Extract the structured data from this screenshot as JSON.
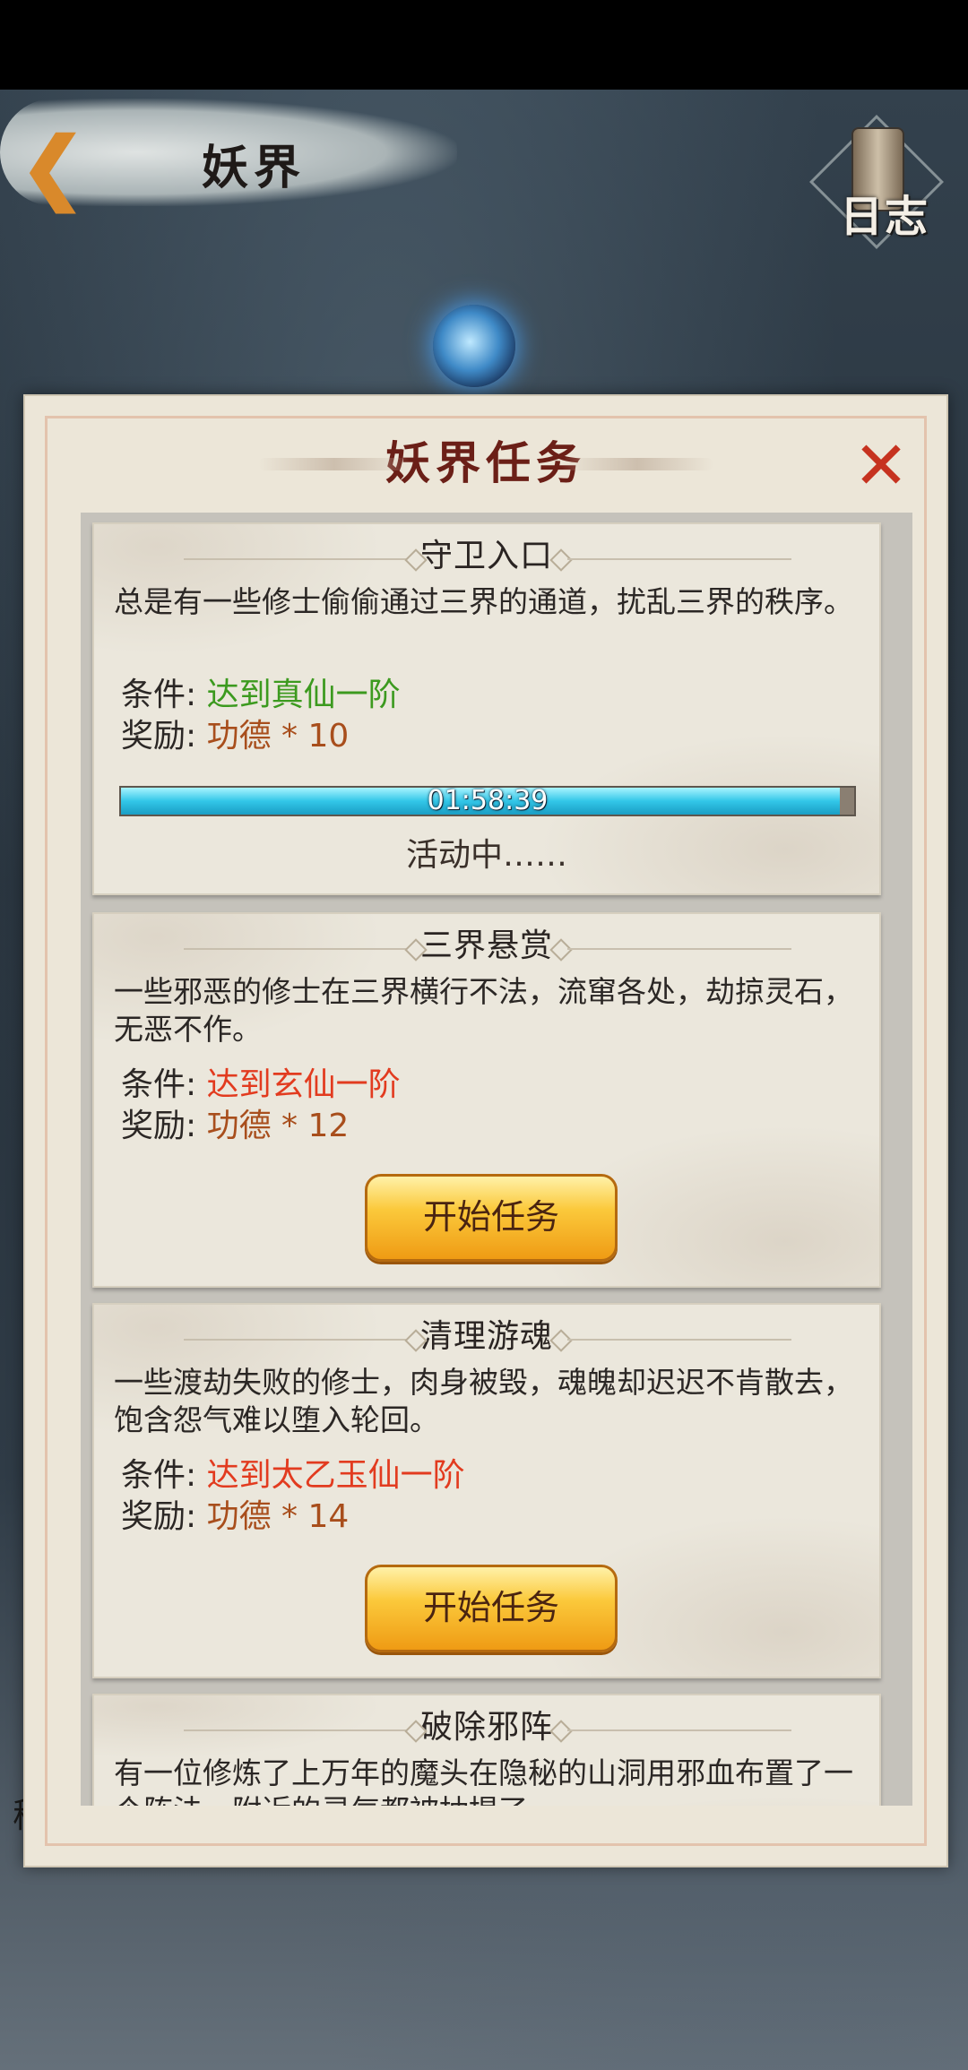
{
  "header": {
    "title": "妖界",
    "log_label": "日志"
  },
  "background": {
    "side_text": "稻"
  },
  "dialog": {
    "title": "妖界任务",
    "tasks": [
      {
        "title": "守卫入口",
        "description": "总是有一些修士偷偷通过三界的通道，扰乱三界的秩序。",
        "condition_label": "条件:",
        "condition_value": "达到真仙一阶",
        "condition_met": true,
        "reward_label": "奖励:",
        "reward_value": "功德 * 10",
        "timer": "01:58:39",
        "progress": 0.98,
        "status": "活动中……"
      },
      {
        "title": "三界悬赏",
        "description": "一些邪恶的修士在三界横行不法，流窜各处，劫掠灵石，无恶不作。",
        "condition_label": "条件:",
        "condition_value": "达到玄仙一阶",
        "condition_met": false,
        "reward_label": "奖励:",
        "reward_value": "功德 * 12",
        "button": "开始任务"
      },
      {
        "title": "清理游魂",
        "description": "一些渡劫失败的修士，肉身被毁，魂魄却迟迟不肯散去，饱含怨气难以堕入轮回。",
        "condition_label": "条件:",
        "condition_value": "达到太乙玉仙一阶",
        "condition_met": false,
        "reward_label": "奖励:",
        "reward_value": "功德 * 14",
        "button": "开始任务"
      },
      {
        "title": "破除邪阵",
        "description": "有一位修炼了上万年的魔头在隐秘的山洞用邪血布置了一个阵法，附近的灵气都被抽提了"
      }
    ]
  },
  "colors": {
    "condition_met": "#3c9a1f",
    "condition_unmet": "#e23b1f",
    "reward": "#a84e1c",
    "title": "#6b1f17",
    "close": "#c6321f"
  }
}
